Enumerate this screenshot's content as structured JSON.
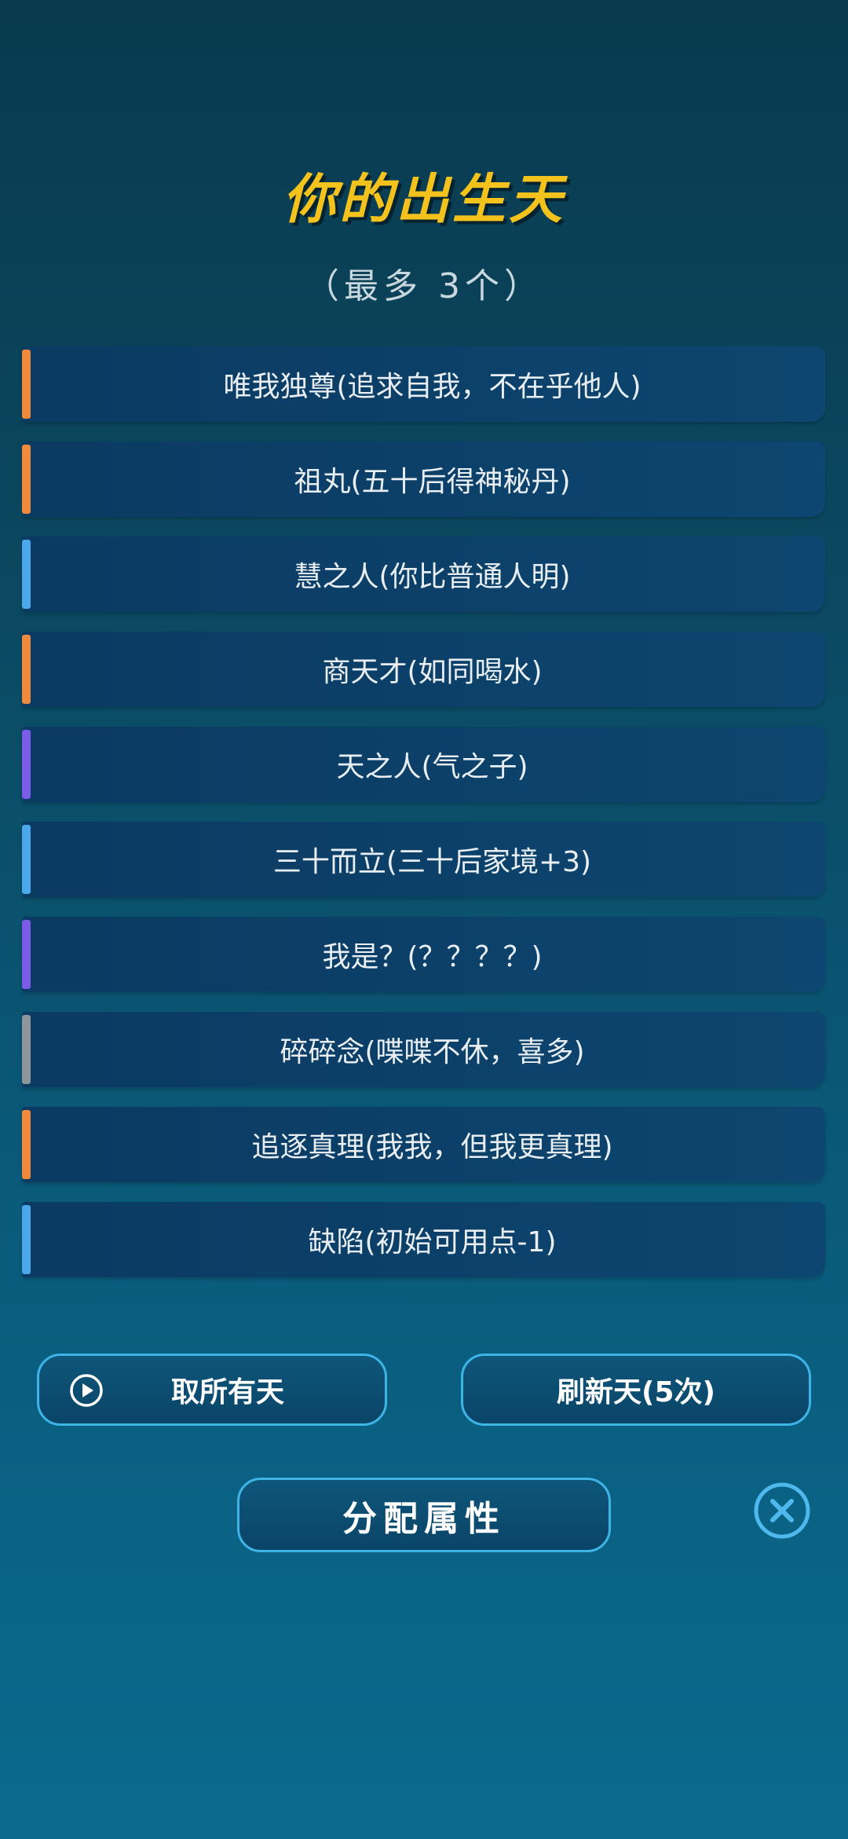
{
  "header": {
    "title": "你的出生天",
    "subtitle": "（最多 3个）"
  },
  "talents": [
    {
      "label": "唯我独尊(追求自我，不在乎他人)",
      "color": "#f08a3c"
    },
    {
      "label": "祖丸(五十后得神秘丹)",
      "color": "#f08a3c"
    },
    {
      "label": "慧之人(你比普通人明)",
      "color": "#4aa8ea"
    },
    {
      "label": "商天才(如同喝水)",
      "color": "#f08a3c"
    },
    {
      "label": "天之人(气之子)",
      "color": "#7a5ce8"
    },
    {
      "label": "三十而立(三十后家境+3)",
      "color": "#4aa8ea"
    },
    {
      "label": "我是？(？？？？)",
      "color": "#7a5ce8"
    },
    {
      "label": "碎碎念(喋喋不休，喜多)",
      "color": "#8c969c"
    },
    {
      "label": "追逐真理(我我，但我更真理)",
      "color": "#f08a3c"
    },
    {
      "label": "缺陷(初始可用点-1)",
      "color": "#4aa8ea"
    }
  ],
  "buttons": {
    "take_all": "取所有天",
    "refresh": "刷新天(5次)",
    "assign": "分配属性"
  },
  "icons": {
    "take_all": "play-circle-icon",
    "close": "close-circle-icon"
  },
  "colors": {
    "title": "#f4c21d",
    "button_border": "#3fb4e6",
    "close_icon": "#4fb8ec"
  }
}
